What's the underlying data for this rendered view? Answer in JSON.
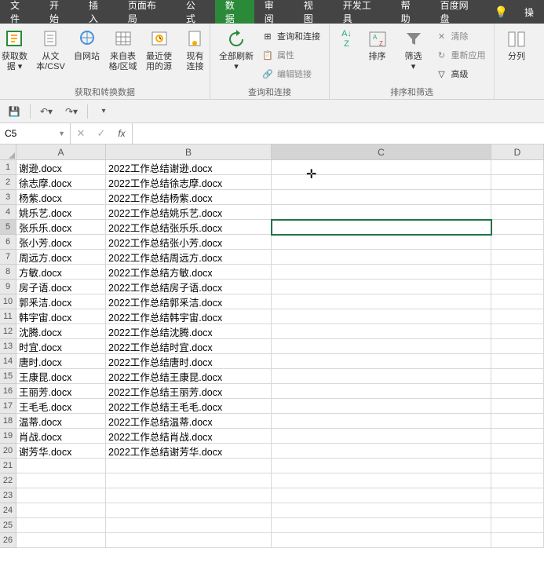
{
  "menu": {
    "tabs": [
      "文件",
      "开始",
      "插入",
      "页面布局",
      "公式",
      "数据",
      "审阅",
      "视图",
      "开发工具",
      "帮助",
      "百度网盘"
    ],
    "activeIndex": 5,
    "tellme": "操"
  },
  "ribbon": {
    "g1": {
      "label": "获取和转换数据",
      "items": [
        "获取数\n据 ▾",
        "从文\n本/CSV",
        "自网站",
        "来自表\n格/区域",
        "最近使\n用的源",
        "现有\n连接"
      ]
    },
    "g2": {
      "label": "查询和连接",
      "refresh": "全部刷新\n▾",
      "q": [
        "查询和连接",
        "属性",
        "编辑链接"
      ]
    },
    "g3": {
      "label": "排序和筛选",
      "sort": "排序",
      "filter": "筛选\n▾",
      "opts": [
        "清除",
        "重新应用",
        "高级"
      ]
    },
    "g4": {
      "label": "",
      "split": "分列"
    }
  },
  "namebox": "C5",
  "formula": "",
  "cols": [
    "A",
    "B",
    "C",
    "D"
  ],
  "rows": [
    {
      "n": 1,
      "a": "谢逊.docx",
      "b": "2022工作总结谢逊.docx"
    },
    {
      "n": 2,
      "a": "徐志摩.docx",
      "b": "2022工作总结徐志摩.docx"
    },
    {
      "n": 3,
      "a": "杨紫.docx",
      "b": "2022工作总结杨紫.docx"
    },
    {
      "n": 4,
      "a": "姚乐艺.docx",
      "b": "2022工作总结姚乐艺.docx"
    },
    {
      "n": 5,
      "a": "张乐乐.docx",
      "b": "2022工作总结张乐乐.docx"
    },
    {
      "n": 6,
      "a": "张小芳.docx",
      "b": "2022工作总结张小芳.docx"
    },
    {
      "n": 7,
      "a": "周远方.docx",
      "b": "2022工作总结周远方.docx"
    },
    {
      "n": 8,
      "a": "方敏.docx",
      "b": "2022工作总结方敏.docx"
    },
    {
      "n": 9,
      "a": "房子语.docx",
      "b": "2022工作总结房子语.docx"
    },
    {
      "n": 10,
      "a": "郭釆洁.docx",
      "b": "2022工作总结郭釆洁.docx"
    },
    {
      "n": 11,
      "a": "韩宇宙.docx",
      "b": "2022工作总结韩宇宙.docx"
    },
    {
      "n": 12,
      "a": "沈腾.docx",
      "b": "2022工作总结沈腾.docx"
    },
    {
      "n": 13,
      "a": "时宜.docx",
      "b": "2022工作总结时宜.docx"
    },
    {
      "n": 14,
      "a": "唐时.docx",
      "b": "2022工作总结唐时.docx"
    },
    {
      "n": 15,
      "a": "王康昆.docx",
      "b": "2022工作总结王康昆.docx"
    },
    {
      "n": 16,
      "a": "王丽芳.docx",
      "b": "2022工作总结王丽芳.docx"
    },
    {
      "n": 17,
      "a": "王毛毛.docx",
      "b": "2022工作总结王毛毛.docx"
    },
    {
      "n": 18,
      "a": "温蒂.docx",
      "b": "2022工作总结温蒂.docx"
    },
    {
      "n": 19,
      "a": "肖战.docx",
      "b": "2022工作总结肖战.docx"
    },
    {
      "n": 20,
      "a": "谢芳华.docx",
      "b": "2022工作总结谢芳华.docx"
    },
    {
      "n": 21,
      "a": "",
      "b": ""
    },
    {
      "n": 22,
      "a": "",
      "b": ""
    },
    {
      "n": 23,
      "a": "",
      "b": ""
    },
    {
      "n": 24,
      "a": "",
      "b": ""
    },
    {
      "n": 25,
      "a": "",
      "b": ""
    },
    {
      "n": 26,
      "a": "",
      "b": ""
    }
  ],
  "selected": {
    "row": 5,
    "col": "C"
  }
}
